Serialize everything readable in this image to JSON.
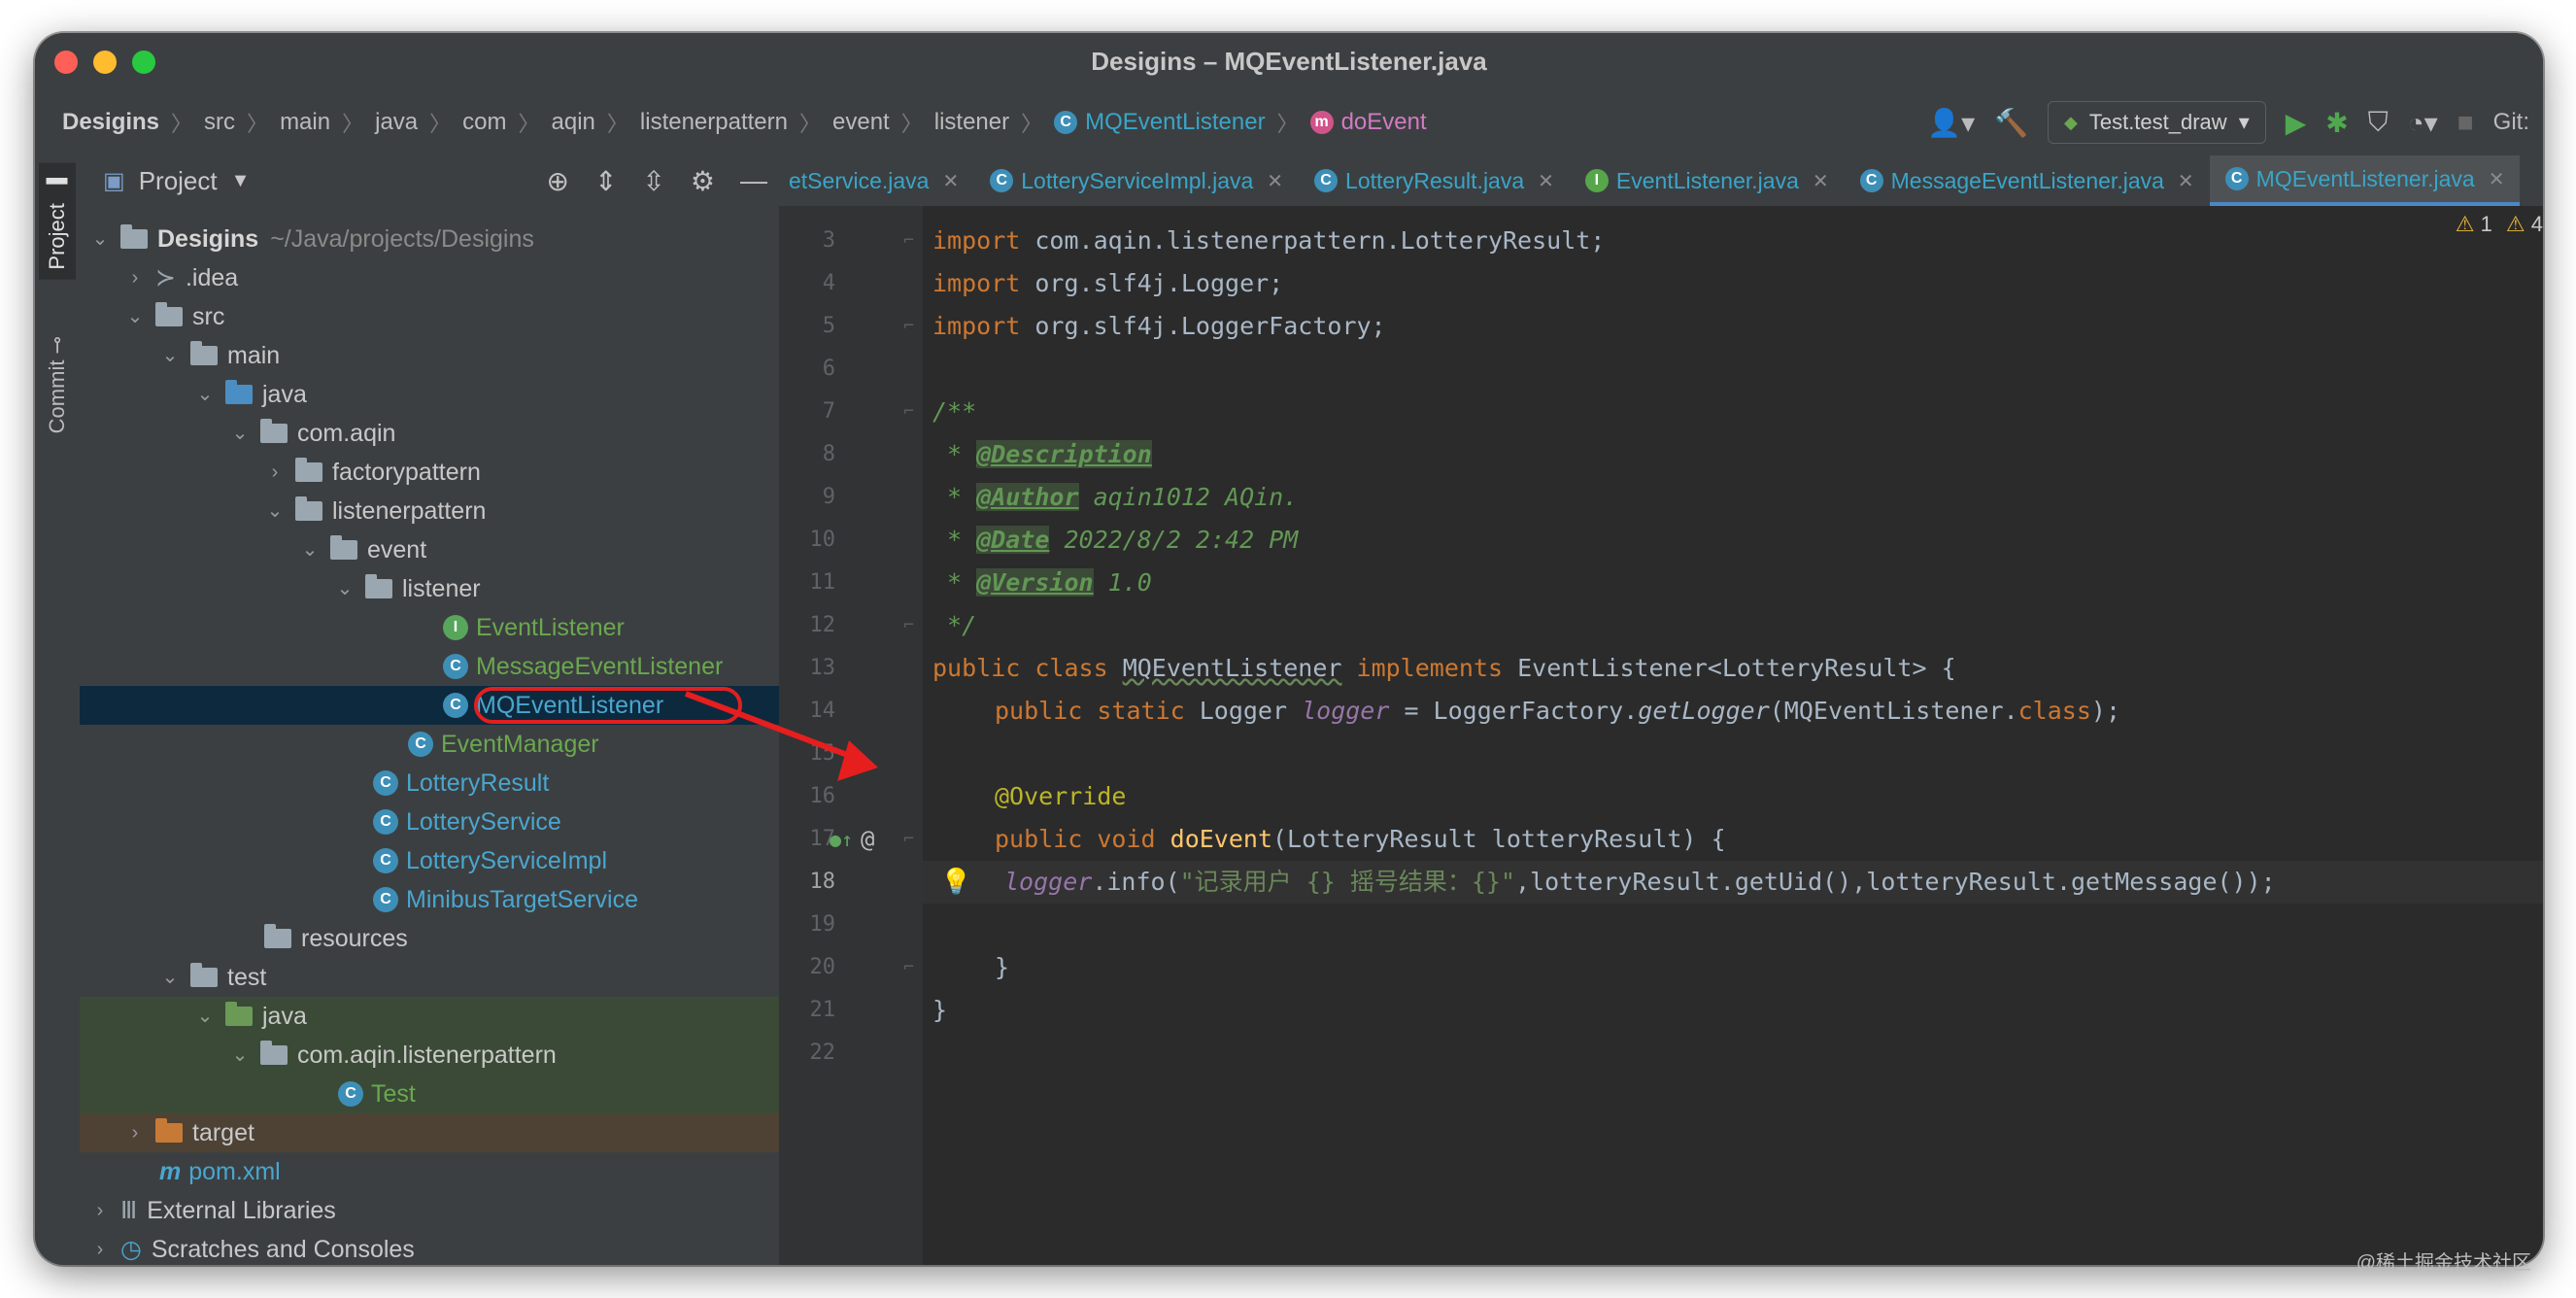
{
  "window": {
    "title": "Desigins – MQEventListener.java"
  },
  "breadcrumbs": [
    {
      "label": "Desigins"
    },
    {
      "label": "src"
    },
    {
      "label": "main"
    },
    {
      "label": "java"
    },
    {
      "label": "com"
    },
    {
      "label": "aqin"
    },
    {
      "label": "listenerpattern"
    },
    {
      "label": "event"
    },
    {
      "label": "listener"
    },
    {
      "label": "MQEventListener"
    },
    {
      "label": "doEvent"
    }
  ],
  "toolbar": {
    "run_config": "Test.test_draw",
    "git_label": "Git:"
  },
  "side_tabs": {
    "project": "Project",
    "commit": "Commit"
  },
  "project_panel": {
    "title": "Project",
    "tree": [
      {
        "label": "Desigins",
        "path": "~/Java/projects/Desigins"
      },
      {
        "label": ".idea"
      },
      {
        "label": "src"
      },
      {
        "label": "main"
      },
      {
        "label": "java"
      },
      {
        "label": "com.aqin"
      },
      {
        "label": "factorypattern"
      },
      {
        "label": "listenerpattern"
      },
      {
        "label": "event"
      },
      {
        "label": "listener"
      },
      {
        "label": "EventListener"
      },
      {
        "label": "MessageEventListener"
      },
      {
        "label": "MQEventListener"
      },
      {
        "label": "EventManager"
      },
      {
        "label": "LotteryResult"
      },
      {
        "label": "LotteryService"
      },
      {
        "label": "LotteryServiceImpl"
      },
      {
        "label": "MinibusTargetService"
      },
      {
        "label": "resources"
      },
      {
        "label": "test"
      },
      {
        "label": "java"
      },
      {
        "label": "com.aqin.listenerpattern"
      },
      {
        "label": "Test"
      },
      {
        "label": "target"
      },
      {
        "label": "pom.xml"
      },
      {
        "label": "External Libraries"
      },
      {
        "label": "Scratches and Consoles"
      }
    ]
  },
  "editor_tabs": [
    {
      "label": "etService.java"
    },
    {
      "label": "LotteryServiceImpl.java"
    },
    {
      "label": "LotteryResult.java"
    },
    {
      "label": "EventListener.java"
    },
    {
      "label": "MessageEventListener.java"
    },
    {
      "label": "MQEventListener.java",
      "active": true
    }
  ],
  "editor": {
    "line_numbers": [
      "3",
      "4",
      "5",
      "6",
      "7",
      "8",
      "9",
      "10",
      "11",
      "12",
      "13",
      "14",
      "15",
      "16",
      "17",
      "18",
      "19",
      "20",
      "21",
      "22"
    ],
    "current_line": "18",
    "warnings": {
      "weak": "1",
      "strong": "4"
    },
    "code": {
      "l3_kw": "import",
      "l3_rest": " com.aqin.listenerpattern.LotteryResult;",
      "l4_kw": "import",
      "l4_rest": " org.slf4j.Logger;",
      "l5_kw": "import",
      "l5_rest": " org.slf4j.LoggerFactory;",
      "l7": "/**",
      "l8_star": " * ",
      "l8_tag": "@Description",
      "l9_star": " * ",
      "l9_tag": "@Author",
      "l9_text": " aqin1012 AQin.",
      "l10_star": " * ",
      "l10_tag": "@Date",
      "l10_text": " 2022/8/2 2:42 PM",
      "l11_star": " * ",
      "l11_tag": "@Version",
      "l11_text": " 1.0",
      "l12": " */",
      "l13_kw1": "public class",
      "l13_name": "MQEventListener",
      "l13_kw2": "implements",
      "l13_rest": " EventListener<LotteryResult> {",
      "l14_kw": "public static",
      "l14_type": " Logger ",
      "l14_field": "logger",
      "l14_eq": " = LoggerFactory.",
      "l14_method": "getLogger",
      "l14_arg": "(MQEventListener.",
      "l14_cls": "class",
      "l14_end": ");",
      "l16_ann": "@Override",
      "l17_kw": "public void",
      "l17_fn": "doEvent",
      "l17_rest": "(LotteryResult lotteryResult) {",
      "l18_field": "logger",
      "l18_call": ".info(",
      "l18_str": "\"记录用户 {} 摇号结果：{}\"",
      "l18_rest": ",lotteryResult.getUid(),lotteryResult.getMessage());",
      "l20": "}",
      "l21": "}"
    }
  },
  "watermark": "@稀土掘金技术社区"
}
